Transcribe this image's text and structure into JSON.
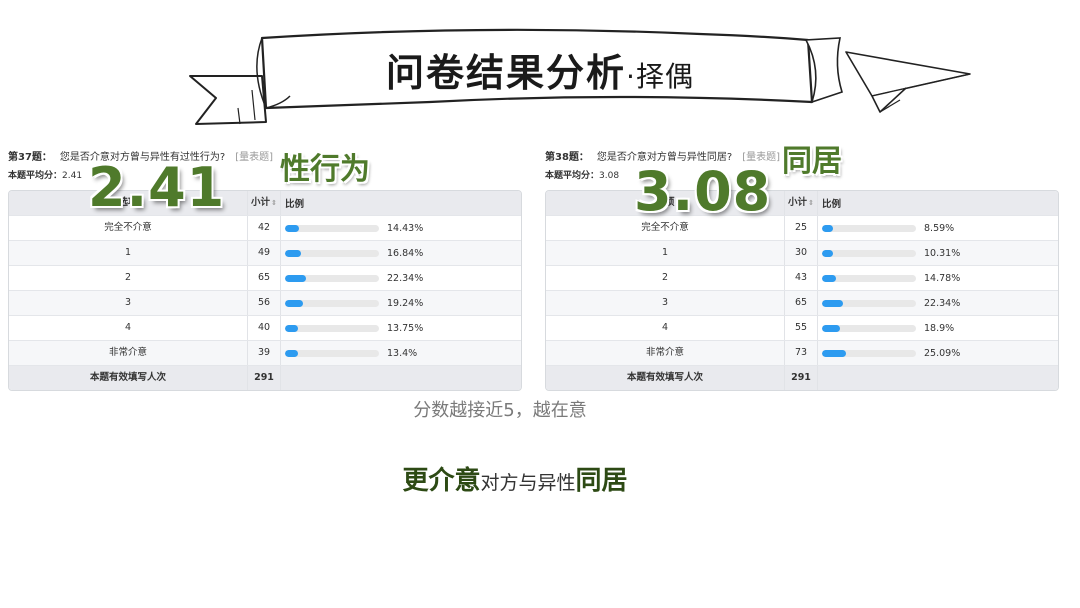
{
  "banner": {
    "title": "问卷结果分析",
    "subtitle": "·择偶"
  },
  "q37": {
    "number": "第37题：",
    "text": "您是否介意对方曾与异性有过性行为?",
    "link": "[量表题]",
    "avg_label": "本题平均分：",
    "avg_value": "2.41",
    "big_number": "2.41",
    "topic": "性行为",
    "header": {
      "option": "选项",
      "count": "小计",
      "ratio": "比例"
    },
    "rows": [
      {
        "option": "完全不介意",
        "count": "42",
        "pct": "14.43%",
        "fraction": 0.1443
      },
      {
        "option": "1",
        "count": "49",
        "pct": "16.84%",
        "fraction": 0.1684
      },
      {
        "option": "2",
        "count": "65",
        "pct": "22.34%",
        "fraction": 0.2234
      },
      {
        "option": "3",
        "count": "56",
        "pct": "19.24%",
        "fraction": 0.1924
      },
      {
        "option": "4",
        "count": "40",
        "pct": "13.75%",
        "fraction": 0.1375
      },
      {
        "option": "非常介意",
        "count": "39",
        "pct": "13.4%",
        "fraction": 0.134
      }
    ],
    "footer": {
      "label": "本题有效填写人次",
      "count": "291"
    }
  },
  "q38": {
    "number": "第38题：",
    "text": "您是否介意对方曾与异性同居?",
    "link": "[量表题]",
    "avg_label": "本题平均分：",
    "avg_value": "3.08",
    "big_number": "3.08",
    "topic": "同居",
    "header": {
      "option": "选项",
      "count": "小计",
      "ratio": "比例"
    },
    "rows": [
      {
        "option": "完全不介意",
        "count": "25",
        "pct": "8.59%",
        "fraction": 0.0859
      },
      {
        "option": "1",
        "count": "30",
        "pct": "10.31%",
        "fraction": 0.1031
      },
      {
        "option": "2",
        "count": "43",
        "pct": "14.78%",
        "fraction": 0.1478
      },
      {
        "option": "3",
        "count": "65",
        "pct": "22.34%",
        "fraction": 0.2234
      },
      {
        "option": "4",
        "count": "55",
        "pct": "18.9%",
        "fraction": 0.189
      },
      {
        "option": "非常介意",
        "count": "73",
        "pct": "25.09%",
        "fraction": 0.2509
      }
    ],
    "footer": {
      "label": "本题有效填写人次",
      "count": "291"
    }
  },
  "note": "分数越接近5，越在意",
  "conclusion": {
    "part1": "更介意",
    "part2": "对方与异性",
    "part3": "同居"
  },
  "colors": {
    "accent_green": "#4f7a2b",
    "bar_blue": "#2d9bf0"
  },
  "icons": {
    "banner": "ribbon-banner-icon",
    "plane": "paper-plane-icon"
  }
}
